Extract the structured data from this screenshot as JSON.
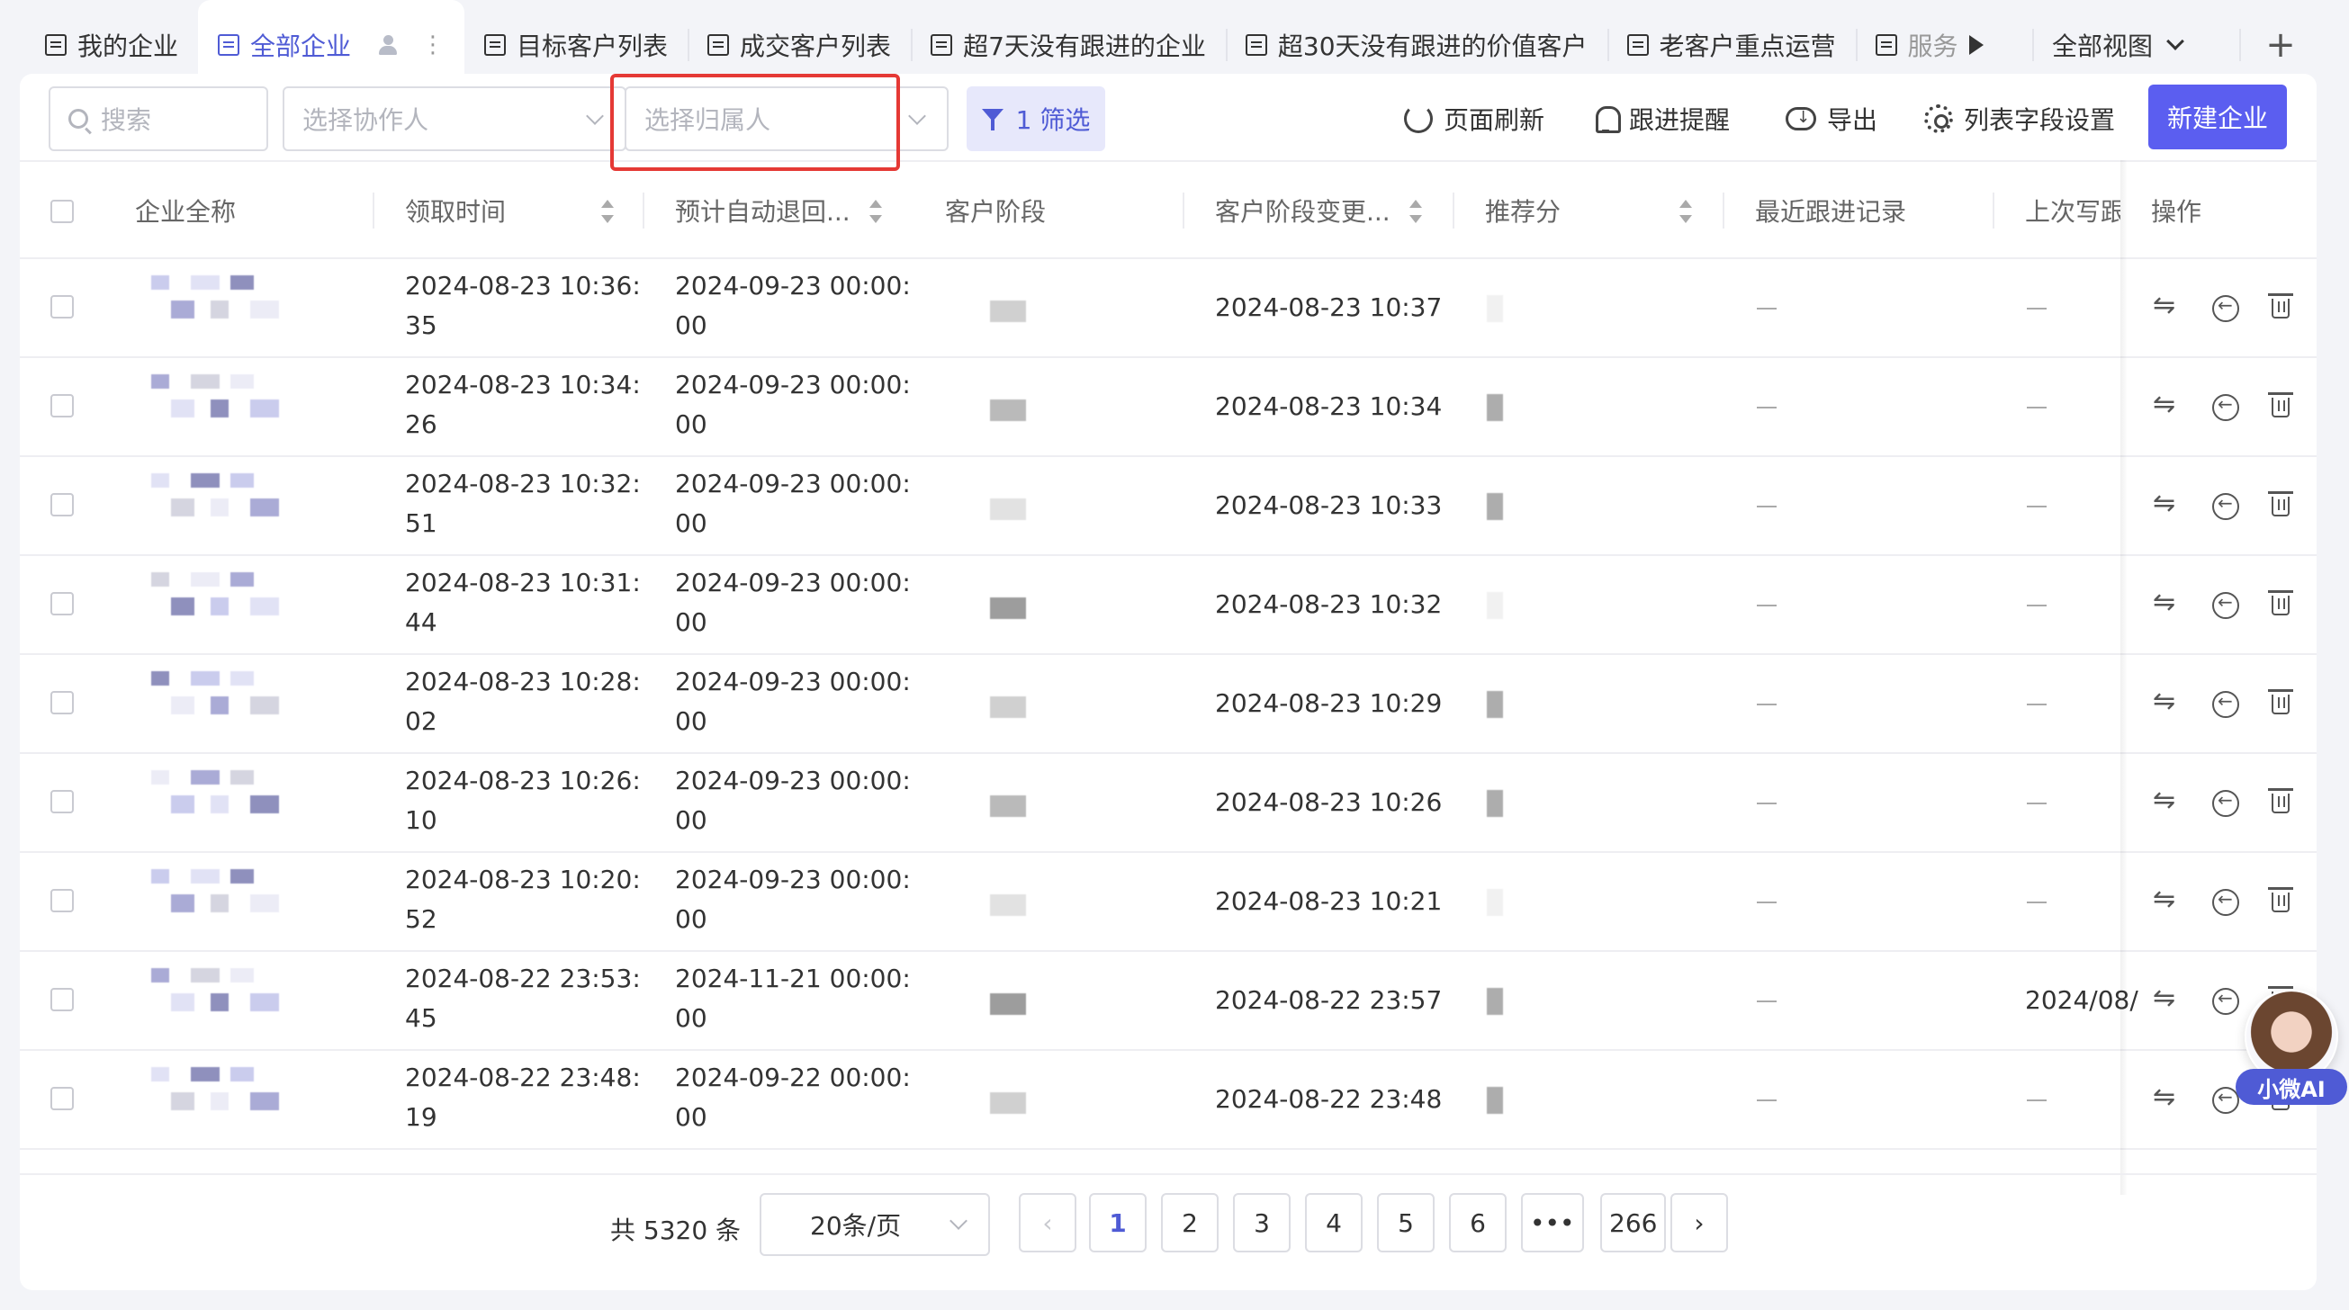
{
  "tabs": [
    {
      "label": "我的企业"
    },
    {
      "label": "全部企业"
    },
    {
      "label": "目标客户列表"
    },
    {
      "label": "成交客户列表"
    },
    {
      "label": "超7天没有跟进的企业"
    },
    {
      "label": "超30天没有跟进的价值客户"
    },
    {
      "label": "老客户重点运营"
    },
    {
      "label": "服务"
    }
  ],
  "view_select": "全部视图",
  "toolbar": {
    "search_placeholder": "搜索",
    "collaborator_placeholder": "选择协作人",
    "owner_placeholder": "选择归属人",
    "filter_label": "1 筛选",
    "refresh_label": "页面刷新",
    "reminder_label": "跟进提醒",
    "export_label": "导出",
    "columns_label": "列表字段设置",
    "new_label": "新建企业"
  },
  "colors": {
    "accent": "#5b5ef0",
    "highlight": "#e53935"
  },
  "table": {
    "headers": [
      "企业全称",
      "领取时间",
      "预计自动退回...",
      "客户阶段",
      "客户阶段变更...",
      "推荐分",
      "最近跟进记录",
      "上次写跟",
      "操作"
    ],
    "rows": [
      {
        "claim": "2024-08-23 10:36:",
        "claim2": "35",
        "ret": "2024-09-23 00:00:",
        "ret2": "00",
        "change": "2024-08-23 10:37",
        "last": ""
      },
      {
        "claim": "2024-08-23 10:34:",
        "claim2": "26",
        "ret": "2024-09-23 00:00:",
        "ret2": "00",
        "change": "2024-08-23 10:34",
        "last": ""
      },
      {
        "claim": "2024-08-23 10:32:",
        "claim2": "51",
        "ret": "2024-09-23 00:00:",
        "ret2": "00",
        "change": "2024-08-23 10:33",
        "last": ""
      },
      {
        "claim": "2024-08-23 10:31:",
        "claim2": "44",
        "ret": "2024-09-23 00:00:",
        "ret2": "00",
        "change": "2024-08-23 10:32",
        "last": ""
      },
      {
        "claim": "2024-08-23 10:28:",
        "claim2": "02",
        "ret": "2024-09-23 00:00:",
        "ret2": "00",
        "change": "2024-08-23 10:29",
        "last": ""
      },
      {
        "claim": "2024-08-23 10:26:",
        "claim2": "10",
        "ret": "2024-09-23 00:00:",
        "ret2": "00",
        "change": "2024-08-23 10:26",
        "last": ""
      },
      {
        "claim": "2024-08-23 10:20:",
        "claim2": "52",
        "ret": "2024-09-23 00:00:",
        "ret2": "00",
        "change": "2024-08-23 10:21",
        "last": ""
      },
      {
        "claim": "2024-08-22 23:53:",
        "claim2": "45",
        "ret": "2024-11-21 00:00:",
        "ret2": "00",
        "change": "2024-08-22 23:57",
        "last": "2024/08/"
      },
      {
        "claim": "2024-08-22 23:48:",
        "claim2": "19",
        "ret": "2024-09-22 00:00:",
        "ret2": "00",
        "change": "2024-08-22 23:48",
        "last": ""
      }
    ]
  },
  "pagination": {
    "total": "共 5320 条",
    "page_size": "20条/页",
    "pages": [
      "1",
      "2",
      "3",
      "4",
      "5",
      "6",
      "•••",
      "266"
    ],
    "current": "1"
  },
  "ai_assistant": "小微AI"
}
